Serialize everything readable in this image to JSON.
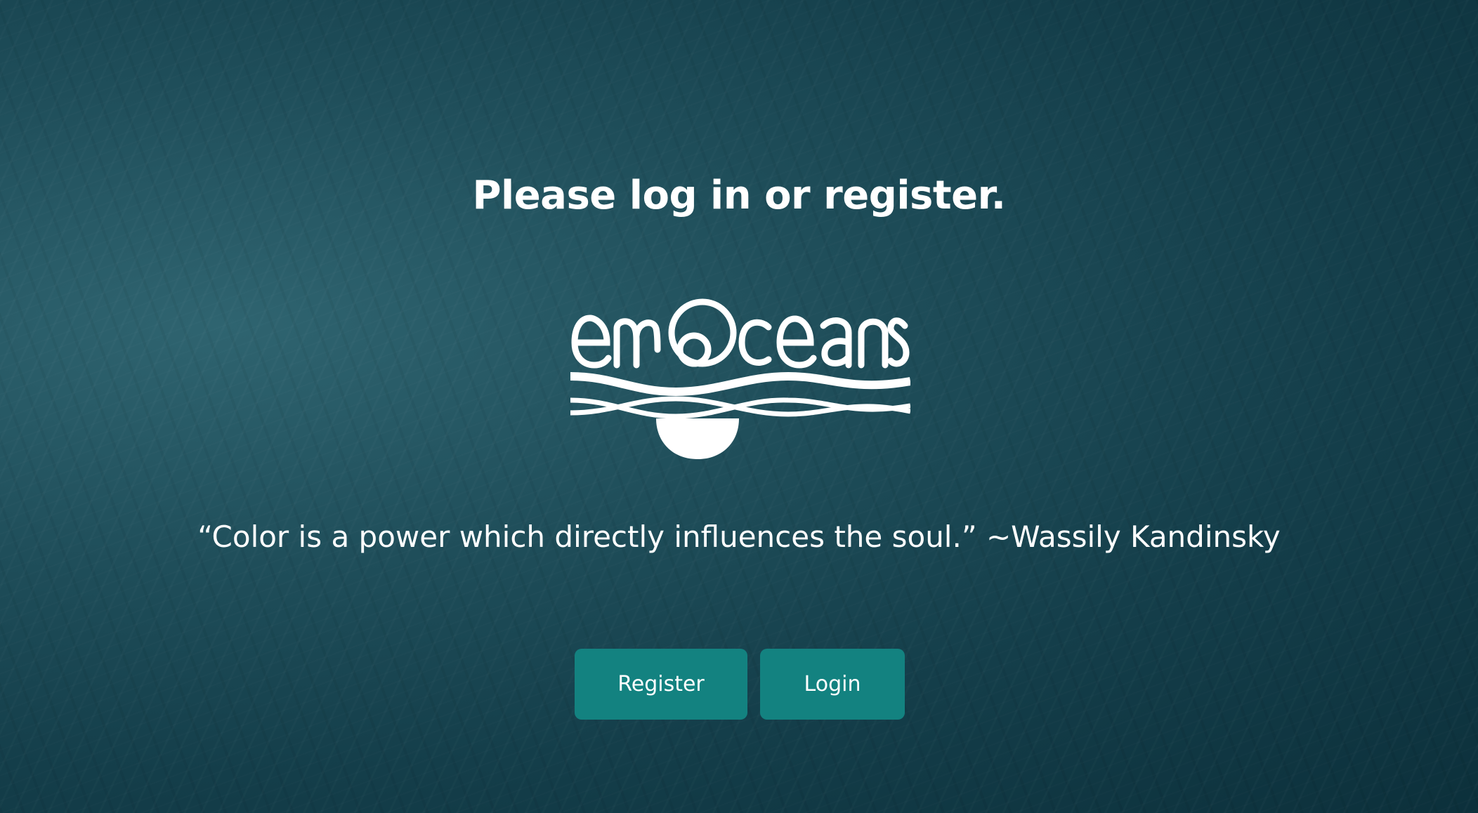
{
  "heading": "Please log in or register.",
  "logo": {
    "text": "emOceans"
  },
  "quote": "“Color is a power which directly influences the soul.” ~Wassily Kandinsky",
  "buttons": {
    "register": "Register",
    "login": "Login"
  },
  "colors": {
    "button": "#138280",
    "background": "#1a4a56"
  }
}
